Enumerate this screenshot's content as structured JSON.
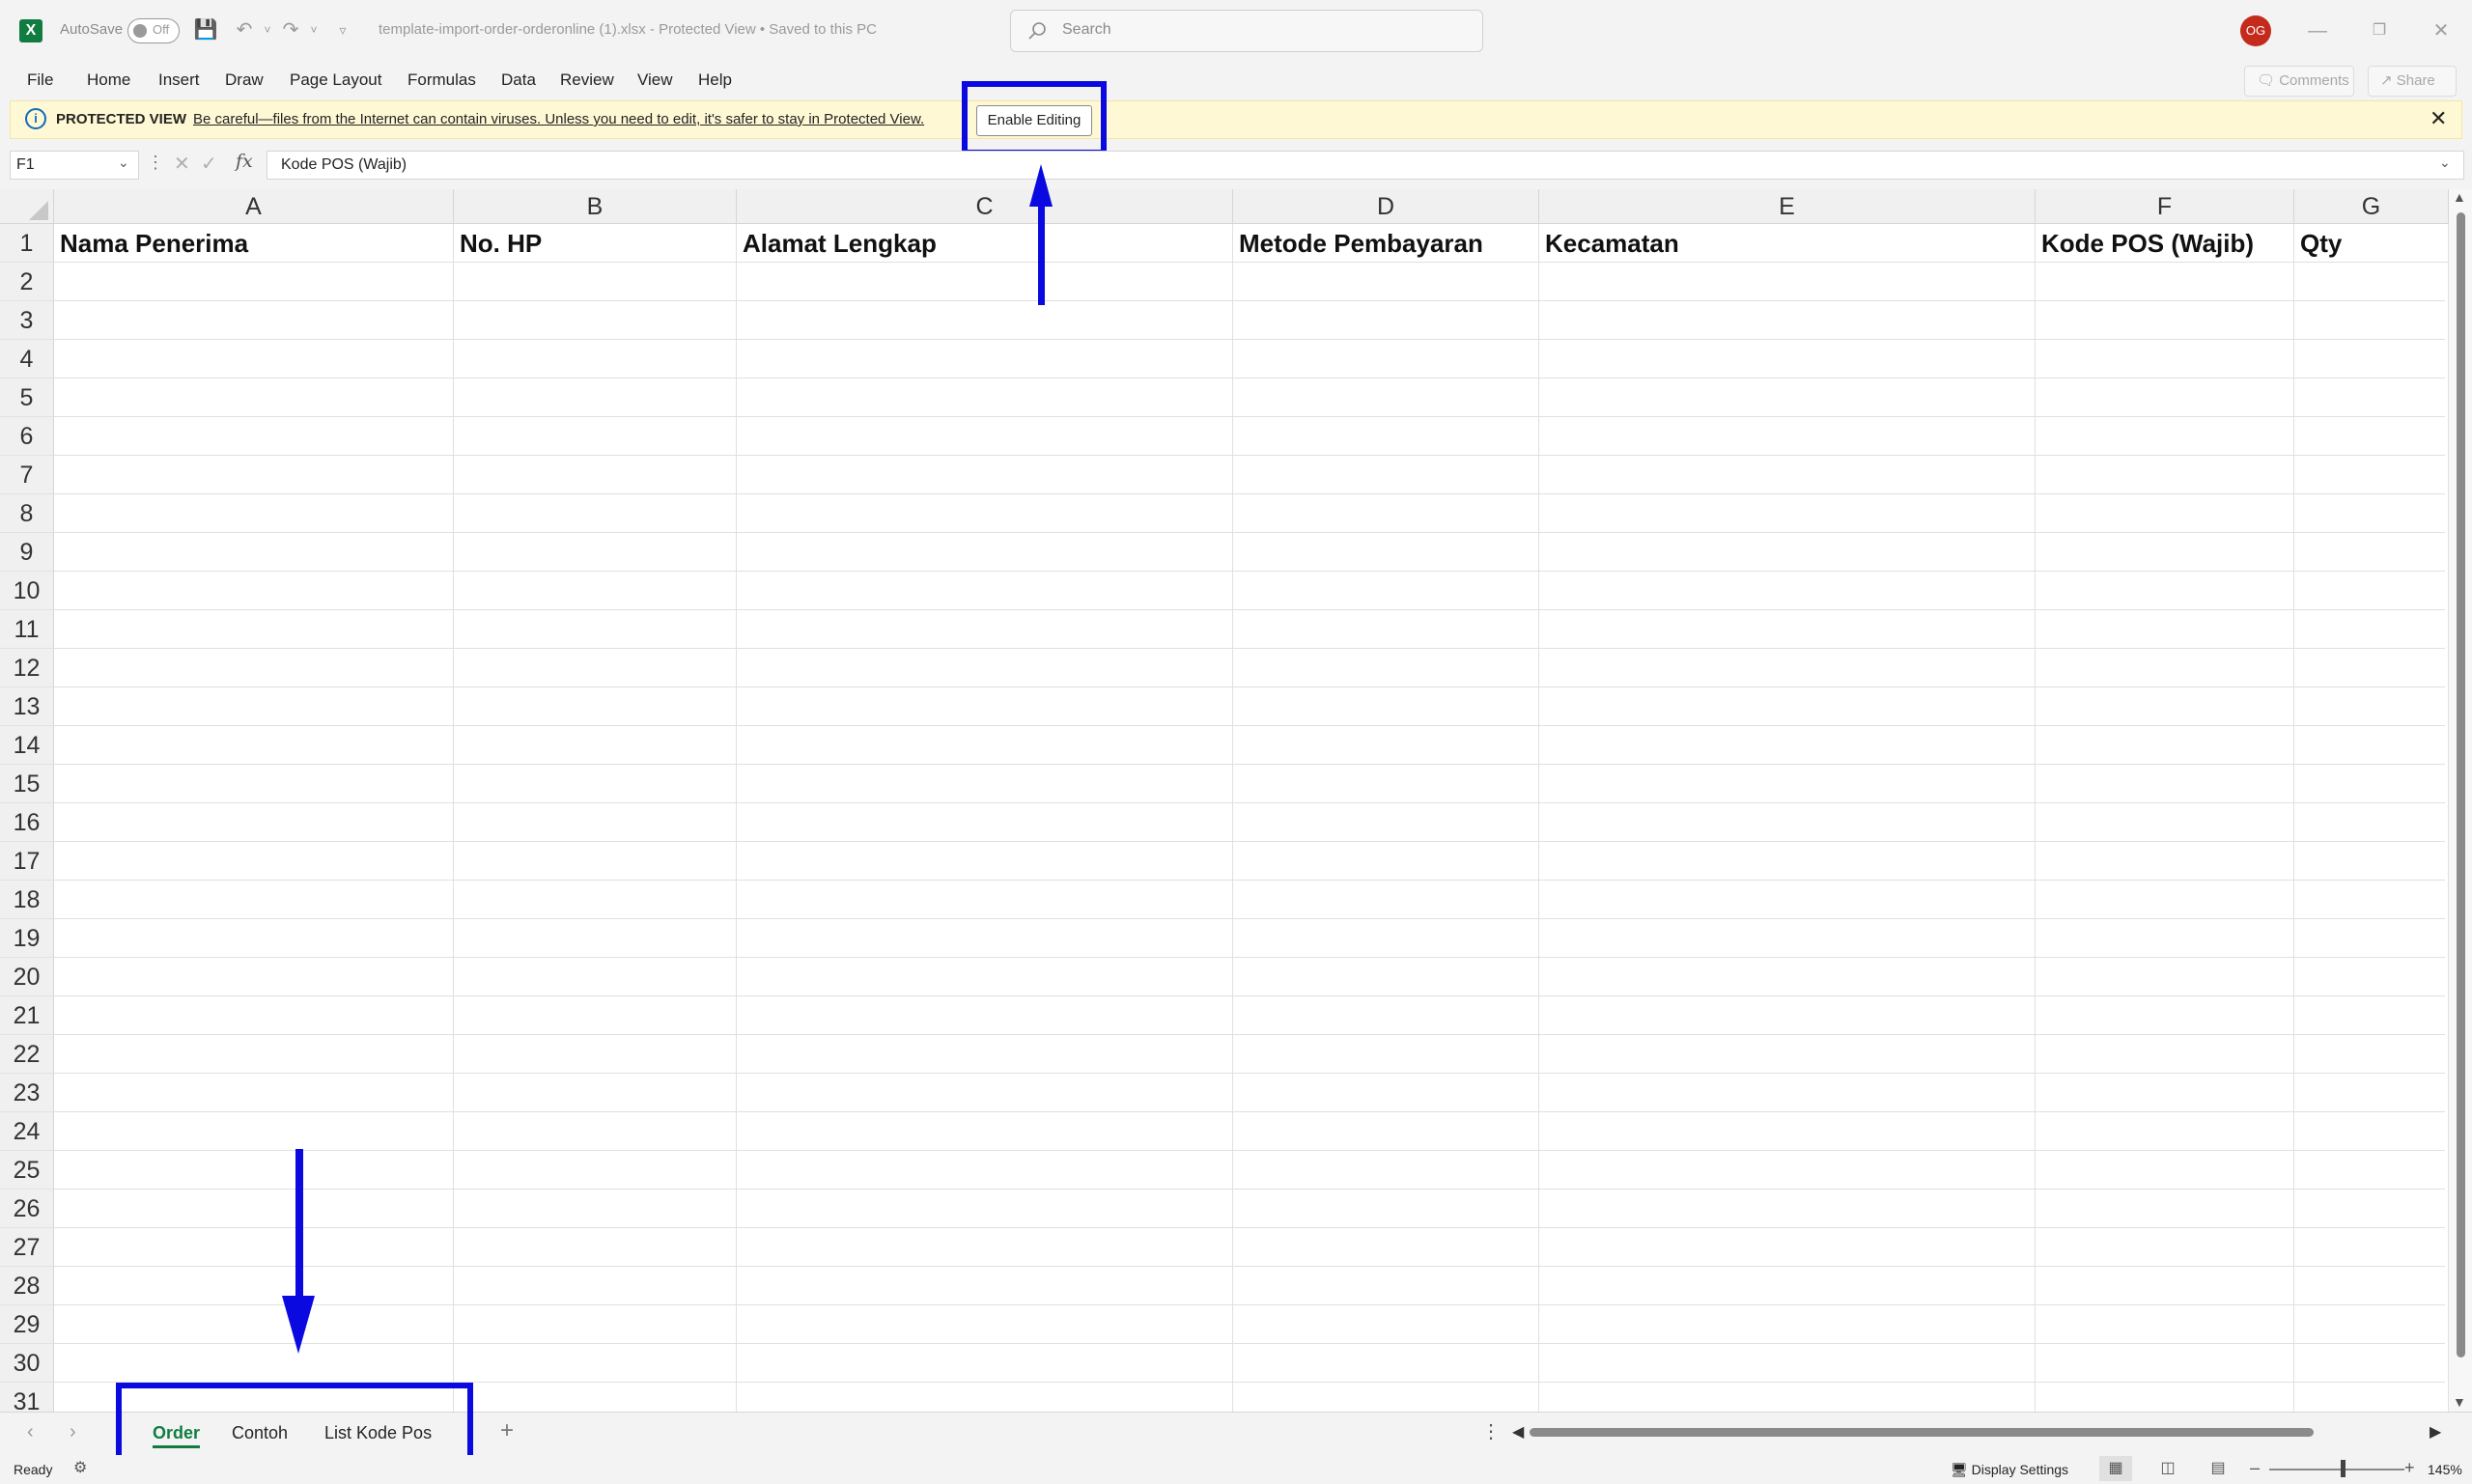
{
  "titlebar": {
    "app_logo": "X",
    "autosave_label": "AutoSave",
    "autosave_state": "Off",
    "filename": "template-import-order-orderonline (1).xlsx  -  Protected View • Saved to this PC",
    "search_placeholder": "Search",
    "user_initials": "OG"
  },
  "menu": {
    "items": [
      "File",
      "Home",
      "Insert",
      "Draw",
      "Page Layout",
      "Formulas",
      "Data",
      "Review",
      "View",
      "Help"
    ],
    "comments_label": "Comments",
    "share_label": "Share"
  },
  "protected_view": {
    "title": "PROTECTED VIEW",
    "message": "Be careful—files from the Internet can contain viruses. Unless you need to edit, it's safer to stay in Protected View.",
    "button_label": "Enable Editing"
  },
  "formula_bar": {
    "name_box": "F1",
    "fx": "fx",
    "value": "Kode POS (Wajib)"
  },
  "grid": {
    "columns": [
      "A",
      "B",
      "C",
      "D",
      "E",
      "F",
      "G"
    ],
    "rows": [
      "1",
      "2",
      "3",
      "4",
      "5",
      "6",
      "7",
      "8",
      "9",
      "10",
      "11",
      "12",
      "13",
      "14",
      "15",
      "16",
      "17",
      "18",
      "19",
      "20",
      "21",
      "22",
      "23",
      "24",
      "25",
      "26",
      "27",
      "28",
      "29",
      "30",
      "31"
    ],
    "row1": [
      "Nama Penerima",
      "No. HP",
      "Alamat Lengkap",
      "Metode Pembayaran",
      "Kecamatan",
      "Kode POS (Wajib)",
      "Qty"
    ]
  },
  "sheets": {
    "tabs": [
      "Order",
      "Contoh",
      "List Kode Pos"
    ],
    "active": "Order"
  },
  "status": {
    "ready": "Ready",
    "display_settings": "Display Settings",
    "zoom": "145%"
  },
  "annotation_color": "#0a0ae0",
  "accent_color": "#107c41"
}
